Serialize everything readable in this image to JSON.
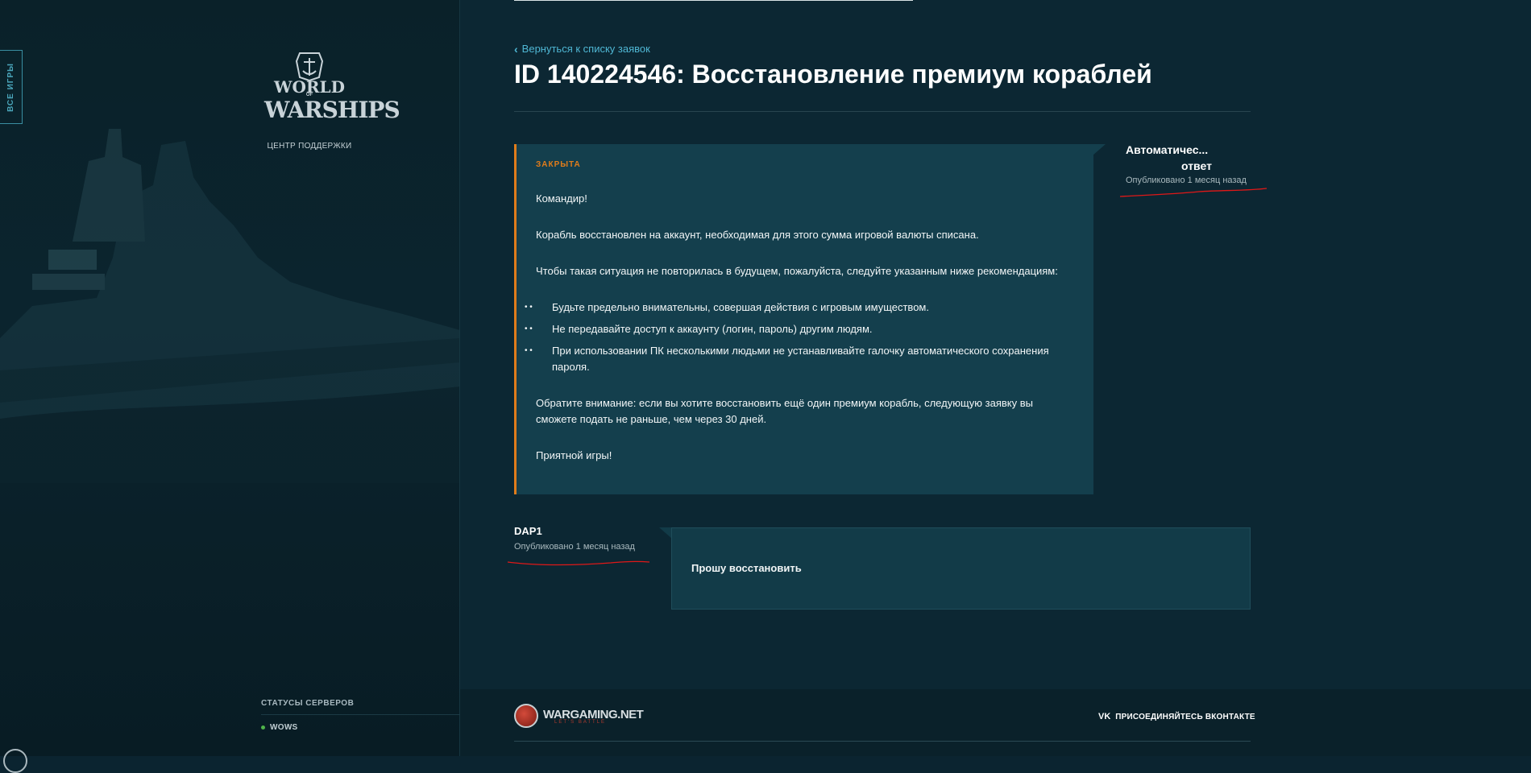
{
  "sidebar": {
    "all_games": "ВСЕ ИГРЫ",
    "logo_line1": "WORLD",
    "logo_of": "OF",
    "logo_line2": "WARSHIPS",
    "support_label": "ЦЕНТР ПОДДЕРЖКИ",
    "server_status_title": "СТАТУСЫ СЕРВЕРОВ",
    "servers": [
      {
        "name": "WOWS",
        "status_color": "#4fb34a"
      }
    ]
  },
  "main": {
    "back_link": "Вернуться к списку заявок",
    "title": "ID 140224546: Восстановление премиум кораблей",
    "ticket_message": {
      "status": "ЗАКРЫТА",
      "greeting": "Командир!",
      "para1": "Корабль восстановлен на аккаунт, необходимая для этого сумма игровой валюты списана.",
      "para2": "Чтобы такая ситуация не повторилась в будущем, пожалуйста, следуйте указанным ниже рекомендациям:",
      "bullets": [
        "Будьте предельно внимательны, совершая действия с игровым имуществом.",
        "Не передавайте доступ к аккаунту (логин, пароль) другим людям.",
        "При использовании ПК несколькими людьми не устанавливайте галочку автоматического сохранения пароля."
      ],
      "para3": "Обратите внимание: если вы хотите восстановить ещё один премиум корабль, следующую заявку вы сможете подать не раньше, чем через 30 дней.",
      "closing": "Приятной игры!",
      "author_line1": "Автоматичес...",
      "author_line2": "ответ",
      "published": "Опубликовано 1 месяц назад"
    },
    "user_reply": {
      "author": "DAP1",
      "published": "Опубликовано 1 месяц назад",
      "text": "Прошу восстановить"
    }
  },
  "footer": {
    "brand": "WARGAMING.NET",
    "brand_sub": "LET'S BATTLE",
    "vk_icon": "vk-icon",
    "vk_label": "ПРИСОЕДИНЯЙТЕСЬ ВКОНТАКТЕ"
  },
  "colors": {
    "accent_link": "#4fb7d4",
    "status_closed": "#e07c1b",
    "card_bg": "#143f4d"
  }
}
